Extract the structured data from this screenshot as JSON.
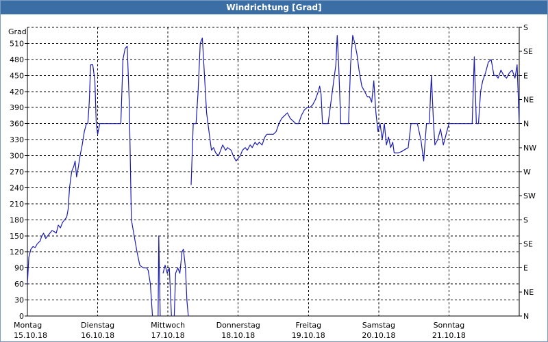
{
  "window": {
    "title": "Windrichtung [Grad]"
  },
  "colors": {
    "titlebar": "#3a6ea5",
    "line": "#1a1ab4",
    "grid": "#000000",
    "plot_bg": "#ffffff"
  },
  "chart_data": {
    "type": "line",
    "title": "Windrichtung [Grad]",
    "ylabel": "Grad",
    "ylim": [
      0,
      540
    ],
    "yticks": [
      0,
      30,
      60,
      90,
      120,
      150,
      180,
      210,
      240,
      270,
      300,
      330,
      360,
      390,
      420,
      450,
      480,
      510
    ],
    "right_axis_labels": [
      "N",
      "NE",
      "E",
      "SE",
      "S",
      "SW",
      "W",
      "NW",
      "N",
      "NE",
      "E",
      "SE",
      "S"
    ],
    "xlim": [
      0,
      7
    ],
    "x_labels": [
      {
        "day": "Montag",
        "date": "15.10.18"
      },
      {
        "day": "Dienstag",
        "date": "16.10.18"
      },
      {
        "day": "Mittwoch",
        "date": "17.10.18"
      },
      {
        "day": "Donnerstag",
        "date": "18.10.18"
      },
      {
        "day": "Freitag",
        "date": "19.10.18"
      },
      {
        "day": "Samstag",
        "date": "20.10.18"
      },
      {
        "day": "Sonntag",
        "date": "21.10.18"
      }
    ],
    "grid": true,
    "series": [
      {
        "segments": [
          [
            [
              0.0,
              60
            ],
            [
              0.02,
              110
            ],
            [
              0.05,
              125
            ],
            [
              0.08,
              130
            ],
            [
              0.11,
              128
            ],
            [
              0.14,
              135
            ],
            [
              0.18,
              140
            ],
            [
              0.2,
              148
            ],
            [
              0.23,
              155
            ],
            [
              0.26,
              145
            ],
            [
              0.29,
              150
            ],
            [
              0.32,
              155
            ],
            [
              0.35,
              160
            ],
            [
              0.38,
              158
            ],
            [
              0.41,
              155
            ],
            [
              0.44,
              170
            ],
            [
              0.47,
              165
            ],
            [
              0.5,
              175
            ],
            [
              0.53,
              180
            ],
            [
              0.56,
              185
            ],
            [
              0.58,
              200
            ],
            [
              0.6,
              240
            ],
            [
              0.63,
              270
            ],
            [
              0.66,
              280
            ],
            [
              0.68,
              290
            ],
            [
              0.7,
              260
            ],
            [
              0.72,
              275
            ],
            [
              0.75,
              300
            ],
            [
              0.78,
              320
            ],
            [
              0.81,
              345
            ],
            [
              0.84,
              360
            ],
            [
              0.86,
              360
            ],
            [
              0.88,
              400
            ],
            [
              0.9,
              470
            ],
            [
              0.93,
              470
            ],
            [
              0.96,
              440
            ],
            [
              0.98,
              360
            ],
            [
              1.0,
              340
            ],
            [
              1.03,
              360
            ],
            [
              1.06,
              360
            ],
            [
              1.1,
              360
            ],
            [
              1.15,
              360
            ],
            [
              1.2,
              360
            ],
            [
              1.25,
              360
            ],
            [
              1.3,
              360
            ],
            [
              1.33,
              360
            ],
            [
              1.36,
              480
            ],
            [
              1.39,
              500
            ],
            [
              1.42,
              505
            ],
            [
              1.45,
              400
            ],
            [
              1.48,
              180
            ],
            [
              1.52,
              150
            ],
            [
              1.56,
              120
            ],
            [
              1.6,
              95
            ],
            [
              1.65,
              90
            ],
            [
              1.7,
              90
            ],
            [
              1.72,
              85
            ],
            [
              1.75,
              60
            ],
            [
              1.78,
              0
            ]
          ],
          [
            [
              1.86,
              0
            ],
            [
              1.87,
              150
            ],
            [
              1.89,
              0
            ]
          ],
          [
            [
              1.93,
              80
            ],
            [
              1.96,
              95
            ],
            [
              1.99,
              80
            ],
            [
              2.02,
              90
            ],
            [
              2.05,
              0
            ]
          ],
          [
            [
              2.09,
              0
            ],
            [
              2.11,
              80
            ],
            [
              2.14,
              90
            ],
            [
              2.17,
              80
            ],
            [
              2.2,
              120
            ],
            [
              2.22,
              125
            ],
            [
              2.25,
              90
            ],
            [
              2.27,
              30
            ],
            [
              2.29,
              0
            ]
          ],
          [
            [
              2.33,
              245
            ],
            [
              2.36,
              360
            ],
            [
              2.4,
              360
            ],
            [
              2.43,
              420
            ],
            [
              2.46,
              510
            ],
            [
              2.49,
              520
            ],
            [
              2.52,
              450
            ],
            [
              2.55,
              380
            ],
            [
              2.58,
              350
            ],
            [
              2.62,
              310
            ],
            [
              2.65,
              315
            ],
            [
              2.68,
              305
            ],
            [
              2.72,
              300
            ],
            [
              2.75,
              310
            ],
            [
              2.78,
              320
            ],
            [
              2.82,
              310
            ],
            [
              2.85,
              315
            ],
            [
              2.9,
              310
            ],
            [
              2.93,
              300
            ],
            [
              2.97,
              290
            ],
            [
              3.0,
              295
            ],
            [
              3.03,
              300
            ],
            [
              3.06,
              310
            ],
            [
              3.1,
              315
            ],
            [
              3.13,
              310
            ],
            [
              3.17,
              320
            ],
            [
              3.2,
              315
            ],
            [
              3.24,
              325
            ],
            [
              3.27,
              320
            ],
            [
              3.3,
              325
            ],
            [
              3.34,
              320
            ],
            [
              3.38,
              335
            ],
            [
              3.41,
              340
            ],
            [
              3.45,
              340
            ],
            [
              3.5,
              340
            ],
            [
              3.54,
              345
            ],
            [
              3.58,
              360
            ],
            [
              3.62,
              370
            ],
            [
              3.66,
              375
            ],
            [
              3.7,
              380
            ],
            [
              3.74,
              370
            ],
            [
              3.78,
              365
            ],
            [
              3.82,
              360
            ],
            [
              3.86,
              360
            ],
            [
              3.9,
              375
            ],
            [
              3.94,
              385
            ],
            [
              3.98,
              390
            ],
            [
              4.02,
              390
            ],
            [
              4.06,
              395
            ],
            [
              4.1,
              405
            ],
            [
              4.14,
              420
            ],
            [
              4.16,
              430
            ],
            [
              4.18,
              415
            ],
            [
              4.2,
              360
            ],
            [
              4.25,
              360
            ],
            [
              4.28,
              360
            ],
            [
              4.32,
              400
            ],
            [
              4.36,
              440
            ],
            [
              4.39,
              470
            ],
            [
              4.41,
              525
            ],
            [
              4.43,
              470
            ],
            [
              4.46,
              360
            ],
            [
              4.5,
              360
            ],
            [
              4.54,
              360
            ],
            [
              4.57,
              360
            ],
            [
              4.6,
              470
            ],
            [
              4.63,
              525
            ],
            [
              4.66,
              510
            ],
            [
              4.69,
              490
            ],
            [
              4.72,
              460
            ],
            [
              4.76,
              430
            ],
            [
              4.8,
              420
            ],
            [
              4.84,
              410
            ],
            [
              4.87,
              410
            ],
            [
              4.9,
              400
            ],
            [
              4.93,
              440
            ],
            [
              4.96,
              380
            ],
            [
              4.99,
              345
            ],
            [
              5.02,
              360
            ],
            [
              5.05,
              330
            ],
            [
              5.08,
              360
            ],
            [
              5.11,
              320
            ],
            [
              5.14,
              335
            ],
            [
              5.17,
              315
            ],
            [
              5.2,
              325
            ],
            [
              5.22,
              305
            ],
            [
              5.28,
              305
            ],
            [
              5.33,
              308
            ],
            [
              5.38,
              312
            ],
            [
              5.42,
              315
            ],
            [
              5.46,
              360
            ],
            [
              5.5,
              360
            ],
            [
              5.55,
              360
            ],
            [
              5.6,
              330
            ],
            [
              5.64,
              290
            ],
            [
              5.68,
              360
            ],
            [
              5.72,
              360
            ],
            [
              5.75,
              450
            ],
            [
              5.78,
              360
            ],
            [
              5.8,
              320
            ],
            [
              5.84,
              330
            ],
            [
              5.88,
              350
            ],
            [
              5.92,
              320
            ],
            [
              5.96,
              340
            ],
            [
              6.0,
              360
            ],
            [
              6.05,
              360
            ],
            [
              6.1,
              360
            ],
            [
              6.15,
              360
            ],
            [
              6.2,
              360
            ],
            [
              6.25,
              360
            ],
            [
              6.3,
              360
            ],
            [
              6.33,
              360
            ],
            [
              6.36,
              485
            ],
            [
              6.39,
              360
            ],
            [
              6.42,
              360
            ],
            [
              6.45,
              420
            ],
            [
              6.48,
              440
            ],
            [
              6.52,
              455
            ],
            [
              6.56,
              475
            ],
            [
              6.6,
              480
            ],
            [
              6.64,
              450
            ],
            [
              6.67,
              450
            ],
            [
              6.7,
              445
            ],
            [
              6.74,
              460
            ],
            [
              6.78,
              450
            ],
            [
              6.82,
              445
            ],
            [
              6.86,
              455
            ],
            [
              6.9,
              460
            ],
            [
              6.94,
              445
            ],
            [
              6.97,
              470
            ],
            [
              7.0,
              360
            ]
          ]
        ]
      }
    ]
  }
}
